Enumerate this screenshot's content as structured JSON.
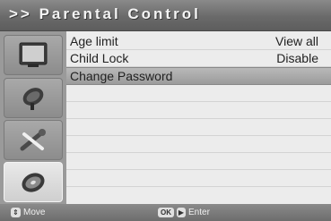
{
  "title": ">> Parental Control",
  "menu": {
    "rows": [
      {
        "label": "Age limit",
        "value": "View all",
        "selected": false
      },
      {
        "label": "Child Lock",
        "value": "Disable",
        "selected": false
      },
      {
        "label": "Change Password",
        "value": "",
        "selected": true
      }
    ]
  },
  "sidebar": {
    "icons": [
      "tv-icon",
      "satellite-dish-icon",
      "tools-icon",
      "cd-icon"
    ],
    "active_index": 3
  },
  "footer": {
    "move_label": "Move",
    "ok_key": "OK",
    "enter_label": "Enter"
  }
}
